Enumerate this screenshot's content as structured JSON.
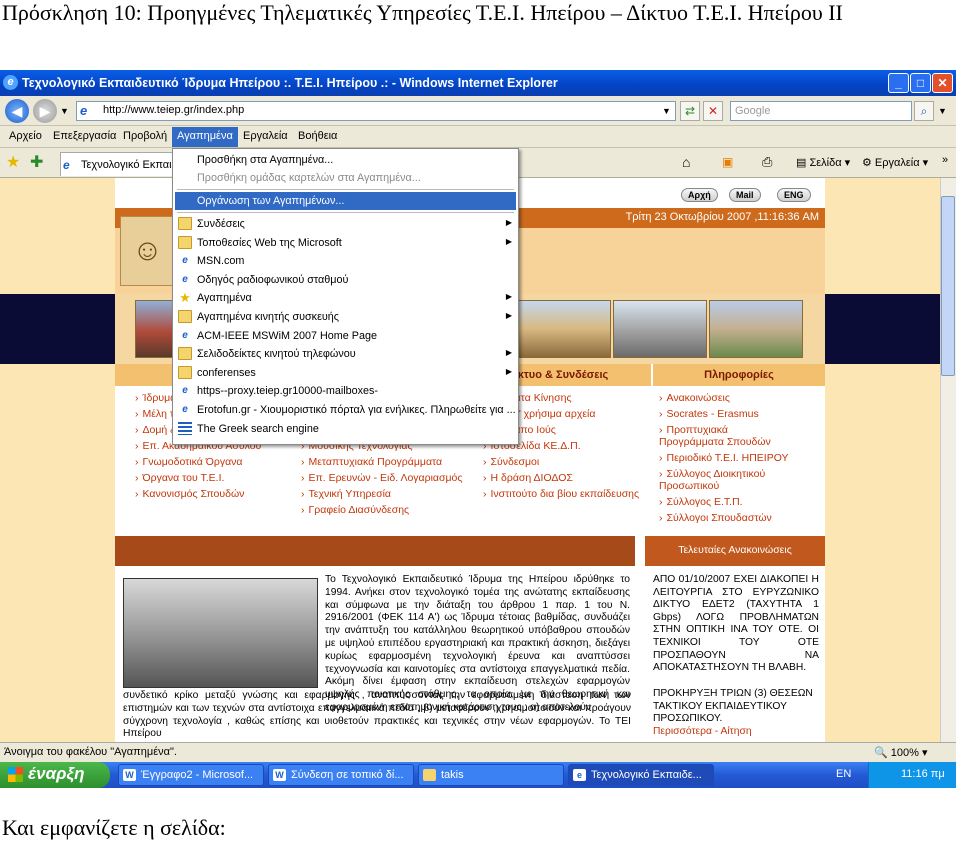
{
  "doc": {
    "title": "Πρόσκληση 10: Προηγμένες Τηλεματικές Υπηρεσίες Τ.Ε.Ι. Ηπείρου – Δίκτυο Τ.Ε.Ι. Ηπείρου ΙΙ",
    "caption": "Και εμφανίζετε η σελίδα:"
  },
  "window": {
    "title": "Τεχνολογικό Εκπαιδευτικό Ίδρυμα Ηπείρου :. Τ.Ε.Ι. Ηπείρου .: - Windows Internet Explorer",
    "minimize": "_",
    "maximize": "□",
    "close": "✕"
  },
  "address": {
    "url": "http://www.teiep.gr/index.php",
    "search_placeholder": "Google"
  },
  "menubar": [
    "Αρχείο",
    "Επεξεργασία",
    "Προβολή",
    "Αγαπημένα",
    "Εργαλεία",
    "Βοήθεια"
  ],
  "tab": {
    "label": "Τεχνολογικό Εκπαιδ"
  },
  "toolbar": {
    "page": "Σελίδα",
    "tools": "Εργαλεία"
  },
  "favorites_menu": {
    "add": "Προσθήκη στα Αγαπημένα...",
    "add_group": "Προσθήκη ομάδας καρτελών στα Αγαπημένα...",
    "organize": "Οργάνωση των Αγαπημένων...",
    "items": [
      {
        "label": "Συνδέσεις",
        "icon": "folder",
        "sub": true
      },
      {
        "label": "Τοποθεσίες Web της Microsoft",
        "icon": "folder",
        "sub": true
      },
      {
        "label": "MSN.com",
        "icon": "ie",
        "sub": false
      },
      {
        "label": "Οδηγός ραδιοφωνικού σταθμού",
        "icon": "ie",
        "sub": false
      },
      {
        "label": "Αγαπημένα",
        "icon": "star",
        "sub": true
      },
      {
        "label": "Αγαπημένα κινητής συσκευής",
        "icon": "folder",
        "sub": true
      },
      {
        "label": "ACM-IEEE MSWiM 2007 Home Page",
        "icon": "ie",
        "sub": false
      },
      {
        "label": "Σελιδοδείκτες κινητού τηλεφώνου",
        "icon": "folder",
        "sub": true
      },
      {
        "label": "conferenses",
        "icon": "folder",
        "sub": true
      },
      {
        "label": "https--proxy.teiep.gr10000-mailboxes-",
        "icon": "ie",
        "sub": false
      },
      {
        "label": "Erotofun.gr - Χιουμοριστικό πόρταλ για ενήλικες. Πληρωθείτε για ...",
        "icon": "ie",
        "sub": false
      },
      {
        "label": "The Greek search engine",
        "icon": "flag",
        "sub": false
      }
    ]
  },
  "site": {
    "date": "Τρίτη 23 Οκτωβρίου 2007 ,11:16:36 AM",
    "buttons": [
      "Αρχή",
      "Mail",
      "ENG"
    ],
    "col_headers": [
      "",
      "κτυο & Συνδέσεις",
      "Πληροφορίες"
    ],
    "col1": [
      "Ίδρυμα",
      "Μέλη το",
      "Δομή &",
      "Επ. Ακαδημαϊκού Ασύλου",
      "Γνωμοδοτικά Όργανα",
      "Όργανα του Τ.Ε.Ι.",
      "Κανονισμός Σπουδών"
    ],
    "col2": [
      "Μουσικής Τεχνολογίας",
      "Μεταπτυχιακά Προγράμματα",
      "Επ. Ερευνών - Ειδ. Λογαριασμός",
      "Τεχνική Υπηρεσία",
      "Γραφείο Διασύνδεσης"
    ],
    "col3": [
      "ράμματα Κίνησης",
      "λάστε\" χρήσιμα αρχεία",
      "ασία απο Ιούς",
      "Ιστοσελίδα ΚΕ.Δ.Π.",
      "Σύνδεσμοι",
      "Η δράση ΔΙΟΔΟΣ",
      "Ινστιτούτο δια βίου εκπαίδευσης"
    ],
    "col4": [
      "Ανακοινώσεις",
      "Socrates - Erasmus",
      "Προπτυχιακά Προγράμματα Σπουδών",
      "Περιοδικό Τ.Ε.Ι. ΗΠΕΙΡΟΥ",
      "Σύλλογος Διοικητικού Προσωπικού",
      "Σύλλογος Ε.Τ.Π.",
      "Σύλλογοι Σπουδαστών"
    ],
    "announcements_title": "Τελευταίες Ανακοινώσεις",
    "body1": "Το Τεχνολογικό Εκπαιδευτικό Ίδρυμα της Ηπείρου ιδρύθηκε το 1994. Ανήκει στον τεχνολογικό τομέα της ανώτατης εκπαίδευσης και σύμφωνα με την διάταξη του άρθρου 1 παρ. 1 του Ν. 2916/2001 (ΦΕΚ 114 Α') ως Ίδρυμα τέτοιας βαθμίδας, συνδυάζει την ανάπτυξη του κατάλληλου θεωρητικού υπόβαθρου σπουδών με υψηλού επιπέδου εργαστηριακή και πρακτική άσκηση, διεξάγει κυρίως εφαρμοσμένη τεχνολογική έρευνα και αναπτύσσει τεχνογνωσία και καινοτομίες στα αντίστοιχα επαγγελματικά πεδία. Ακόμη δίνει έμφαση στην εκπαίδευση στελεχών εφαρμογών υψηλής ποιοτικής στάθμης, τα οποία, με την θεωρητική και εφαρμοσμένη επιστημονική κατάρτιση τους : α) αποτελούν",
    "body2": "συνδετικό κρίκο μεταξύ γνώσης και εφαρμογής , αναπτύσσοντας την εφαρμοσμένη διάσταση των των επιστημών και των τεχνών στα αντίστοιχα επαγγελματικά πεδία , β) μεταφέρουν ,χρησιμοποιούν και προάγουν σύγχρονη τεχνολογία , καθώς επίσης και υιοθετούν πρακτικές και τεχνικές στην νέων εφαρμογών. Το ΤΕΙ Ηπείρου",
    "ann1": "ΑΠΟ 01/10/2007 ΕΧΕΙ ΔΙΑΚΟΠΕΙ Η ΛΕΙΤΟΥΡΓΙΑ ΣΤΟ ΕΥΡΥΖΩΝΙΚΟ ΔΙΚΤΥΟ ΕΔΕΤ2 (ΤΑΧΥΤΗΤΑ 1 Gbps) ΛΟΓΩ ΠΡΟΒΛΗΜΑΤΩΝ ΣΤΗΝ ΟΠΤΙΚΗ ΙΝΑ ΤΟΥ ΟΤΕ. ΟΙ ΤΕΧΝΙΚΟΙ ΤΟΥ ΟΤΕ ΠΡΟΣΠΑΘΟΥΝ ΝΑ ΑΠΟΚΑΤΑΣΤΗΣΟΥΝ ΤΗ ΒΛΑΒΗ.",
    "ann2": "ΠΡΟΚΗΡΥΞΗ ΤΡΙΩΝ (3) ΘΕΣΕΩΝ ΤΑΚΤΙΚΟΥ ΕΚΠΑΙΔΕΥΤΙΚΟΥ ΠΡΟΣΩΠΙΚΟΥ.",
    "ann_link": "Περισσότερα - Αίτηση"
  },
  "status": {
    "text": "Άνοιγμα του φακέλου \"Αγαπημένα\".",
    "zoom": "100%"
  },
  "taskbar": {
    "start": "έναρξη",
    "tasks": [
      "Έγγραφο2 - Microsof...",
      "Σύνδεση σε τοπικό δί...",
      "takis",
      "Τεχνολογικό Εκπαιδε..."
    ],
    "lang": "EN",
    "time": "11:16 πμ"
  }
}
